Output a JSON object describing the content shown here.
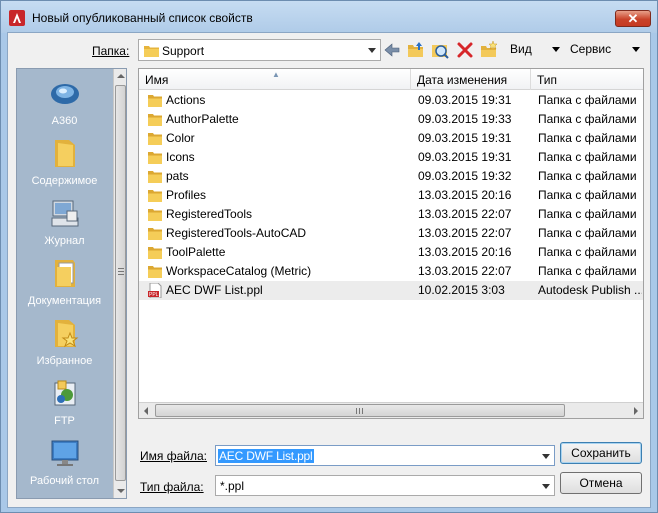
{
  "window": {
    "title": "Новый опубликованный список свойств",
    "close_label": "✕"
  },
  "toolbar": {
    "folder_label": "Папка:",
    "folder_value": "Support",
    "view_label": "Вид",
    "service_label": "Сервис",
    "icons": [
      "back-icon",
      "up-folder-icon",
      "search-web-icon",
      "delete-icon",
      "new-folder-icon"
    ]
  },
  "places": [
    {
      "label": "A360",
      "icon": "a360-icon"
    },
    {
      "label": "Содержимое",
      "icon": "folder-icon"
    },
    {
      "label": "Журнал",
      "icon": "history-icon"
    },
    {
      "label": "Документация",
      "icon": "documents-icon"
    },
    {
      "label": "Избранное",
      "icon": "favorites-icon"
    },
    {
      "label": "FTP",
      "icon": "ftp-icon"
    },
    {
      "label": "Рабочий стол",
      "icon": "desktop-icon"
    }
  ],
  "filelist": {
    "columns": [
      "Имя",
      "Дата изменения",
      "Тип"
    ],
    "rows": [
      {
        "name": "Actions",
        "date": "09.03.2015 19:31",
        "type": "Папка с файлами",
        "icon": "folder-icon"
      },
      {
        "name": "AuthorPalette",
        "date": "09.03.2015 19:33",
        "type": "Папка с файлами",
        "icon": "folder-icon"
      },
      {
        "name": "Color",
        "date": "09.03.2015 19:31",
        "type": "Папка с файлами",
        "icon": "folder-icon"
      },
      {
        "name": "Icons",
        "date": "09.03.2015 19:31",
        "type": "Папка с файлами",
        "icon": "folder-icon"
      },
      {
        "name": "pats",
        "date": "09.03.2015 19:32",
        "type": "Папка с файлами",
        "icon": "folder-icon"
      },
      {
        "name": "Profiles",
        "date": "13.03.2015 20:16",
        "type": "Папка с файлами",
        "icon": "folder-icon"
      },
      {
        "name": "RegisteredTools",
        "date": "13.03.2015 22:07",
        "type": "Папка с файлами",
        "icon": "folder-icon"
      },
      {
        "name": "RegisteredTools-AutoCAD",
        "date": "13.03.2015 22:07",
        "type": "Папка с файлами",
        "icon": "folder-icon"
      },
      {
        "name": "ToolPalette",
        "date": "13.03.2015 20:16",
        "type": "Папка с файлами",
        "icon": "folder-icon"
      },
      {
        "name": "WorkspaceCatalog (Metric)",
        "date": "13.03.2015 22:07",
        "type": "Папка с файлами",
        "icon": "folder-icon"
      },
      {
        "name": "AEC DWF List.ppl",
        "date": "10.02.2015 3:03",
        "type": "Autodesk Publish ...",
        "icon": "ppl-file-icon"
      }
    ]
  },
  "form": {
    "filename_label": "Имя файла:",
    "filename_value": "AEC DWF List.ppl",
    "filetype_label": "Тип файла:",
    "filetype_value": "*.ppl",
    "save_label": "Сохранить",
    "cancel_label": "Отмена"
  }
}
